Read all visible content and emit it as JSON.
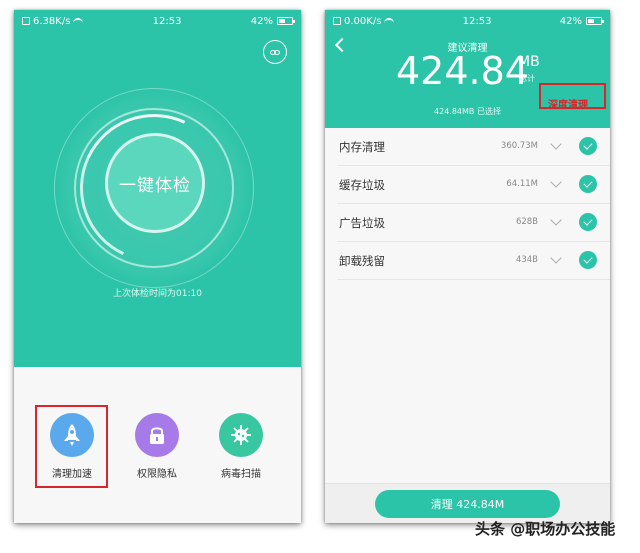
{
  "left_screen": {
    "status": {
      "net_speed": "6.38K/s",
      "time": "12:53",
      "battery": "42%"
    },
    "main_button": "一键体检",
    "last_check": "上次体检时间为01:10",
    "tools": [
      {
        "label": "清理加速",
        "icon": "rocket-icon",
        "color": "#5aa9ec"
      },
      {
        "label": "权限隐私",
        "icon": "lock-icon",
        "color": "#a67ae8"
      },
      {
        "label": "病毒扫描",
        "icon": "virus-icon",
        "color": "#39c7a2"
      }
    ]
  },
  "right_screen": {
    "status": {
      "net_speed": "0.00K/s",
      "time": "12:53",
      "battery": "42%"
    },
    "title": "建议清理",
    "total_size": "424.84",
    "total_unit": "MB",
    "total_label": "总计",
    "selected_text": "424.84MB 已选择",
    "deep_clean": "深度清理",
    "items": [
      {
        "name": "内存清理",
        "size": "360.73M"
      },
      {
        "name": "缓存垃圾",
        "size": "64.11M"
      },
      {
        "name": "广告垃圾",
        "size": "628B"
      },
      {
        "name": "卸载残留",
        "size": "434B"
      }
    ],
    "clean_button": "清理 424.84M"
  },
  "watermark": "头条 @职场办公技能",
  "colors": {
    "accent": "#2cc4a8",
    "highlight": "#d9262c"
  }
}
